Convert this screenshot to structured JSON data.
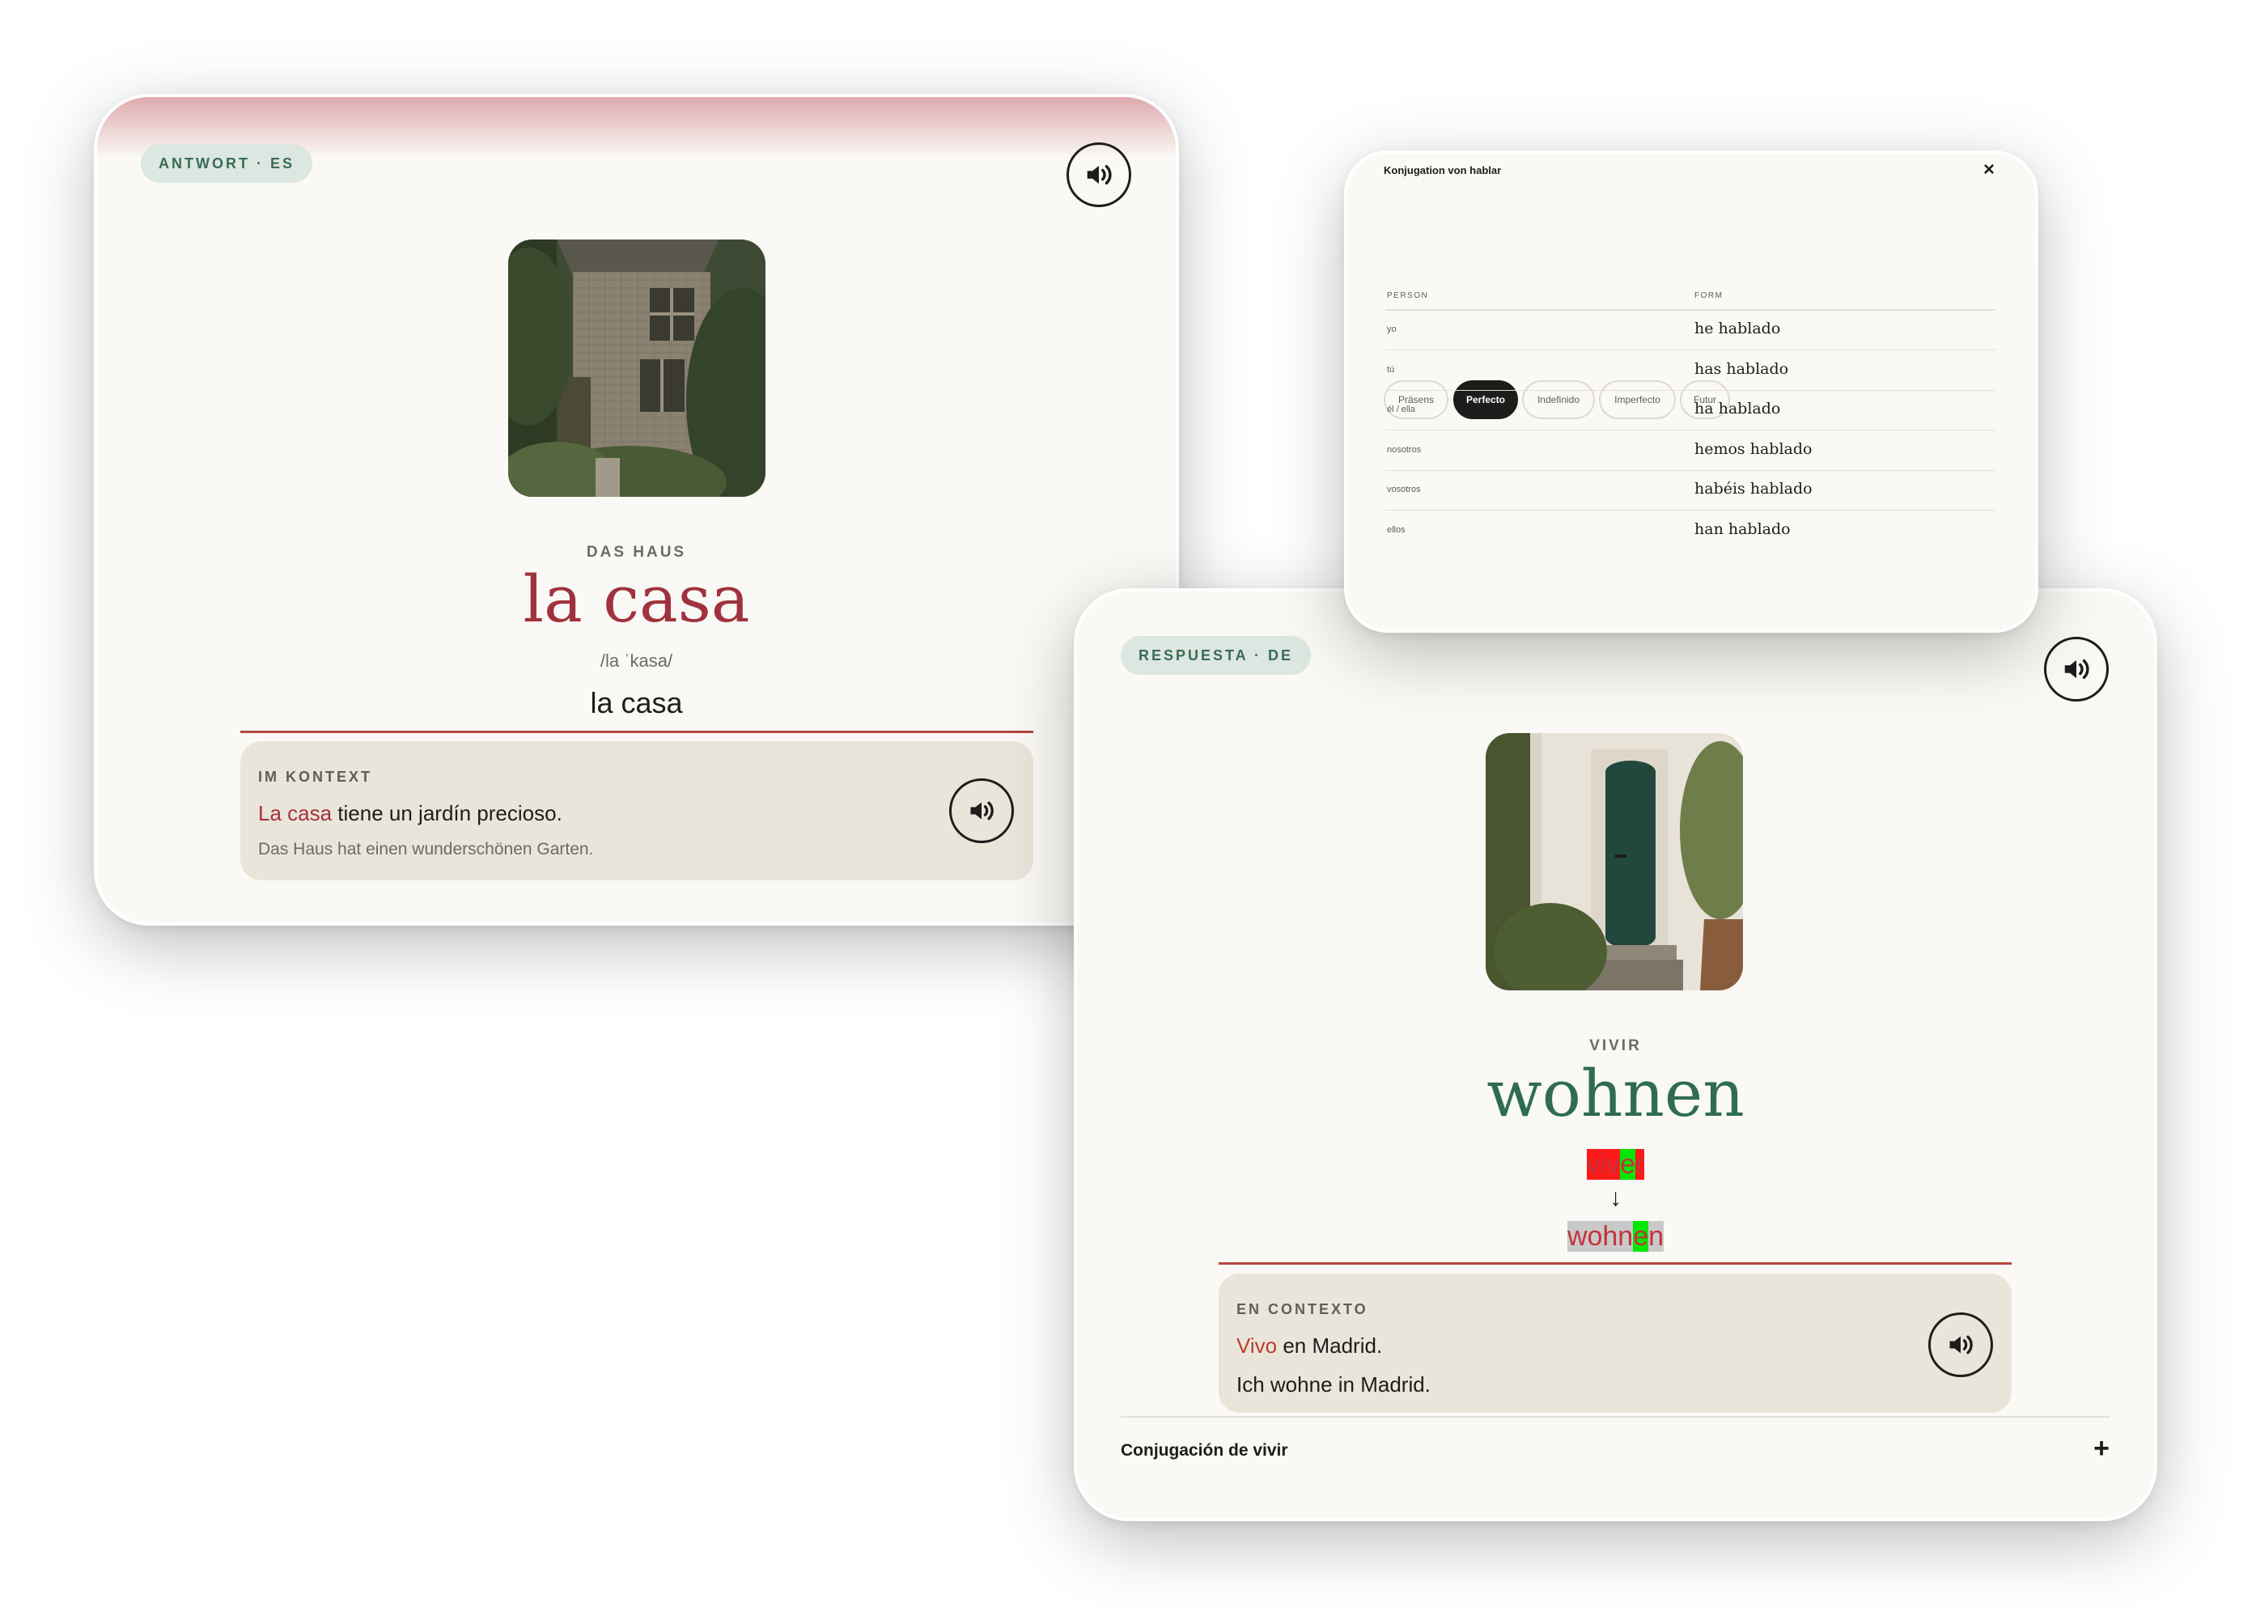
{
  "card_es": {
    "badge": "ANTWORT · ES",
    "translation_caps": "DAS HAUS",
    "word": "la casa",
    "ipa": "/la ˈkasa/",
    "typed_answer": "la casa",
    "context": {
      "label": "IM KONTEXT",
      "sentence_highlight": "La casa",
      "sentence_rest": " tiene un jardín precioso.",
      "translation": "Das Haus hat einen wunderschönen Garten."
    }
  },
  "card_de": {
    "badge": "RESPUESTA · DE",
    "translation_caps": "VIVIR",
    "word": "wohnen",
    "diff_typed": [
      "viv",
      "e",
      "r"
    ],
    "arrow": "↓",
    "diff_correct": [
      "wohn",
      "e",
      "n"
    ],
    "context": {
      "label": "EN CONTEXTO",
      "sentence_highlight": "Vivo",
      "sentence_rest": " en Madrid.",
      "translation": "Ich wohne in Madrid."
    },
    "conjugation_toggle": {
      "label": "Conjugación de vivir",
      "icon": "+"
    }
  },
  "conjugation_modal": {
    "title": "Konjugation von hablar",
    "close": "×",
    "tabs": [
      "Präsens",
      "Perfecto",
      "Indefinido",
      "Imperfecto",
      "Futur"
    ],
    "active_tab": "Perfecto",
    "headers": {
      "person": "PERSON",
      "form": "FORM"
    },
    "rows": [
      {
        "person": "yo",
        "form": "he hablado"
      },
      {
        "person": "tú",
        "form": "has hablado"
      },
      {
        "person": "él / ella",
        "form": "ha hablado"
      },
      {
        "person": "nosotros",
        "form": "hemos hablado"
      },
      {
        "person": "vosotros",
        "form": "habéis hablado"
      },
      {
        "person": "ellos",
        "form": "han hablado"
      }
    ]
  },
  "colors": {
    "accent_red": "#a8313b",
    "accent_green": "#2f6b55",
    "card_bg": "#faf9f5",
    "context_bg": "#eae5da"
  },
  "icons": {
    "speaker": "speaker-icon",
    "close": "close-icon",
    "expand": "plus-icon"
  }
}
